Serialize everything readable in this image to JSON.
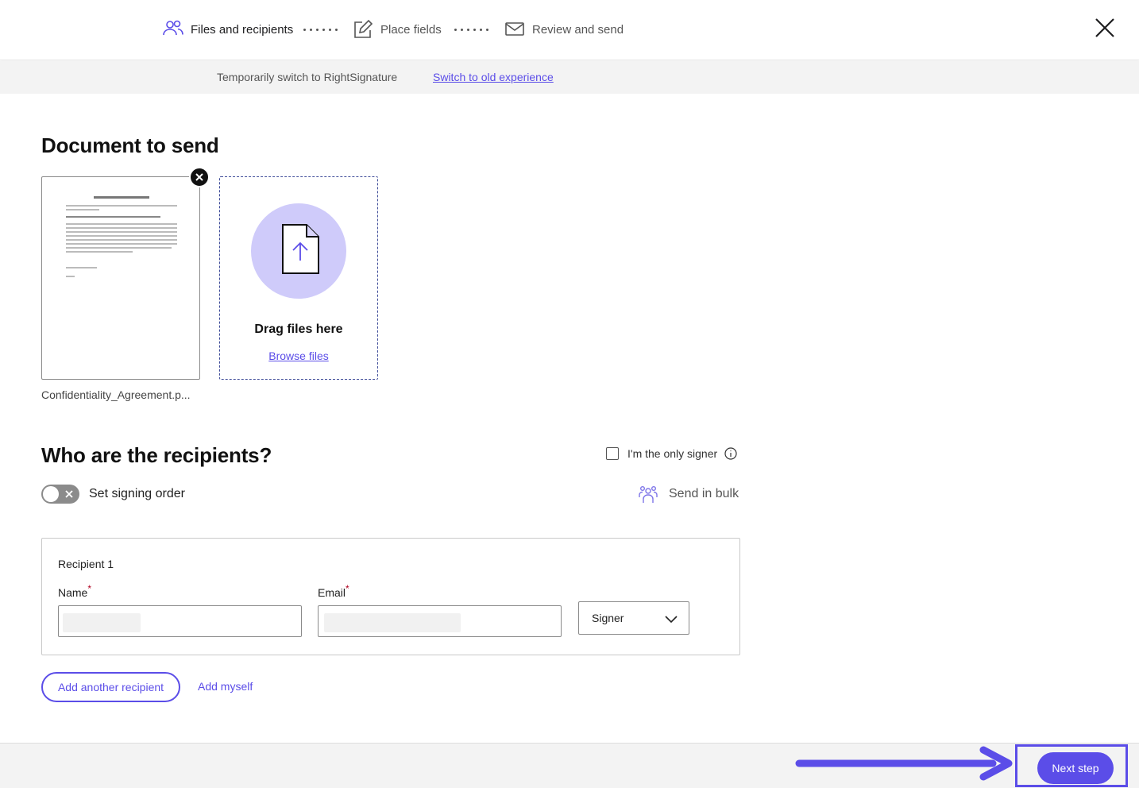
{
  "stepper": {
    "steps": [
      {
        "label": "Files and recipients",
        "icon": "people-icon",
        "active": true
      },
      {
        "label": "Place fields",
        "icon": "edit-icon",
        "active": false
      },
      {
        "label": "Review and send",
        "icon": "envelope-icon",
        "active": false
      }
    ],
    "close_icon": "close-icon"
  },
  "banner": {
    "text": "Temporarily switch to RightSignature",
    "link": "Switch to old experience"
  },
  "document_section": {
    "title": "Document to send",
    "file": {
      "name": "Confidentiality_Agreement.p...",
      "remove_icon": "close-circle-icon"
    },
    "dropzone": {
      "icon": "file-upload-icon",
      "title": "Drag files here",
      "link": "Browse files"
    }
  },
  "recipients_section": {
    "title": "Who are the recipients?",
    "only_signer_label": "I'm the only signer",
    "only_signer_checked": false,
    "signing_order_label": "Set signing order",
    "signing_order_enabled": false,
    "send_in_bulk_label": "Send in bulk",
    "recipients": [
      {
        "title": "Recipient 1",
        "name_label": "Name",
        "email_label": "Email",
        "required_mark": "*",
        "name_value": "",
        "email_value": "",
        "role": "Signer"
      }
    ],
    "add_recipient_label": "Add another recipient",
    "add_myself_label": "Add myself"
  },
  "footer": {
    "next_label": "Next step"
  },
  "colors": {
    "accent": "#5b4de8",
    "accent_light": "#cfcbfa",
    "required": "#b00020",
    "banner_bg": "#f3f3f3"
  }
}
